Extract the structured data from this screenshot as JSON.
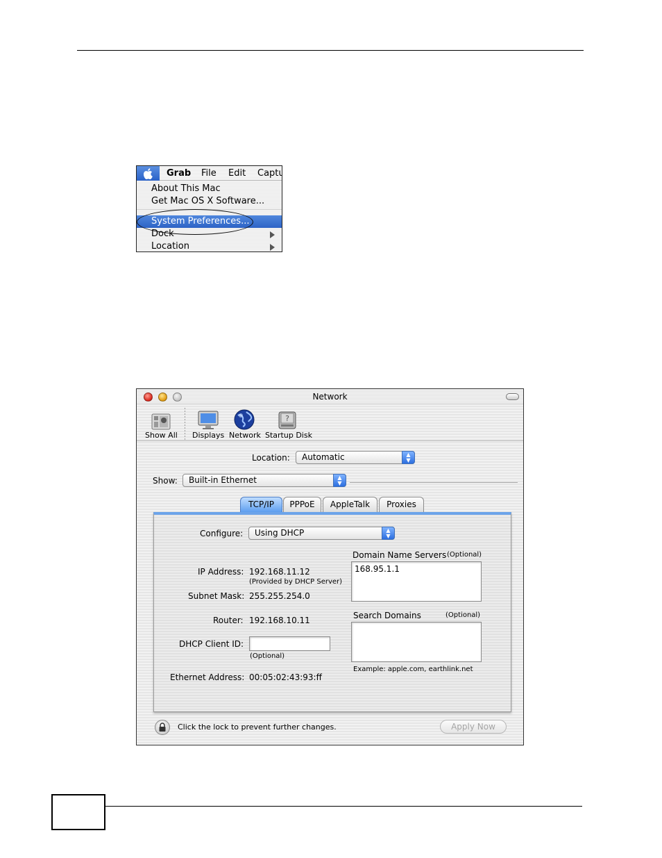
{
  "apple_menu": {
    "menubar": [
      "Grab",
      "File",
      "Edit",
      "Captu"
    ],
    "items": [
      {
        "label": "About This Mac"
      },
      {
        "label": "Get Mac OS X Software..."
      },
      {
        "label": "System Preferences..."
      },
      {
        "label": "Dock"
      },
      {
        "label": "Location"
      }
    ],
    "selected_item": "System Preferences..."
  },
  "network_window": {
    "title": "Network",
    "toolbar": [
      "Show All",
      "Displays",
      "Network",
      "Startup Disk"
    ],
    "location_label": "Location:",
    "location_value": "Automatic",
    "show_label": "Show:",
    "show_value": "Built-in Ethernet",
    "tabs": [
      "TCP/IP",
      "PPPoE",
      "AppleTalk",
      "Proxies"
    ],
    "active_tab": "TCP/IP",
    "configure_label": "Configure:",
    "configure_value": "Using DHCP",
    "ip_label": "IP Address:",
    "ip_value": "192.168.11.12",
    "ip_note": "(Provided by DHCP Server)",
    "subnet_label": "Subnet Mask:",
    "subnet_value": "255.255.254.0",
    "router_label": "Router:",
    "router_value": "192.168.10.11",
    "dhcp_label": "DHCP Client ID:",
    "dhcp_value": "",
    "dhcp_note": "(Optional)",
    "ethernet_label": "Ethernet Address:",
    "ethernet_value": "00:05:02:43:93:ff",
    "dns_label": "Domain Name Servers",
    "dns_optional": "(Optional)",
    "dns_value": "168.95.1.1",
    "search_label": "Search Domains",
    "search_optional": "(Optional)",
    "search_value": "",
    "example": "Example: apple.com, earthlink.net",
    "lock_text": "Click the lock to prevent further changes.",
    "apply_button": "Apply Now"
  },
  "colors": {
    "selection_blue": "#2d63c6",
    "tab_blue": "#5e9ff0"
  }
}
